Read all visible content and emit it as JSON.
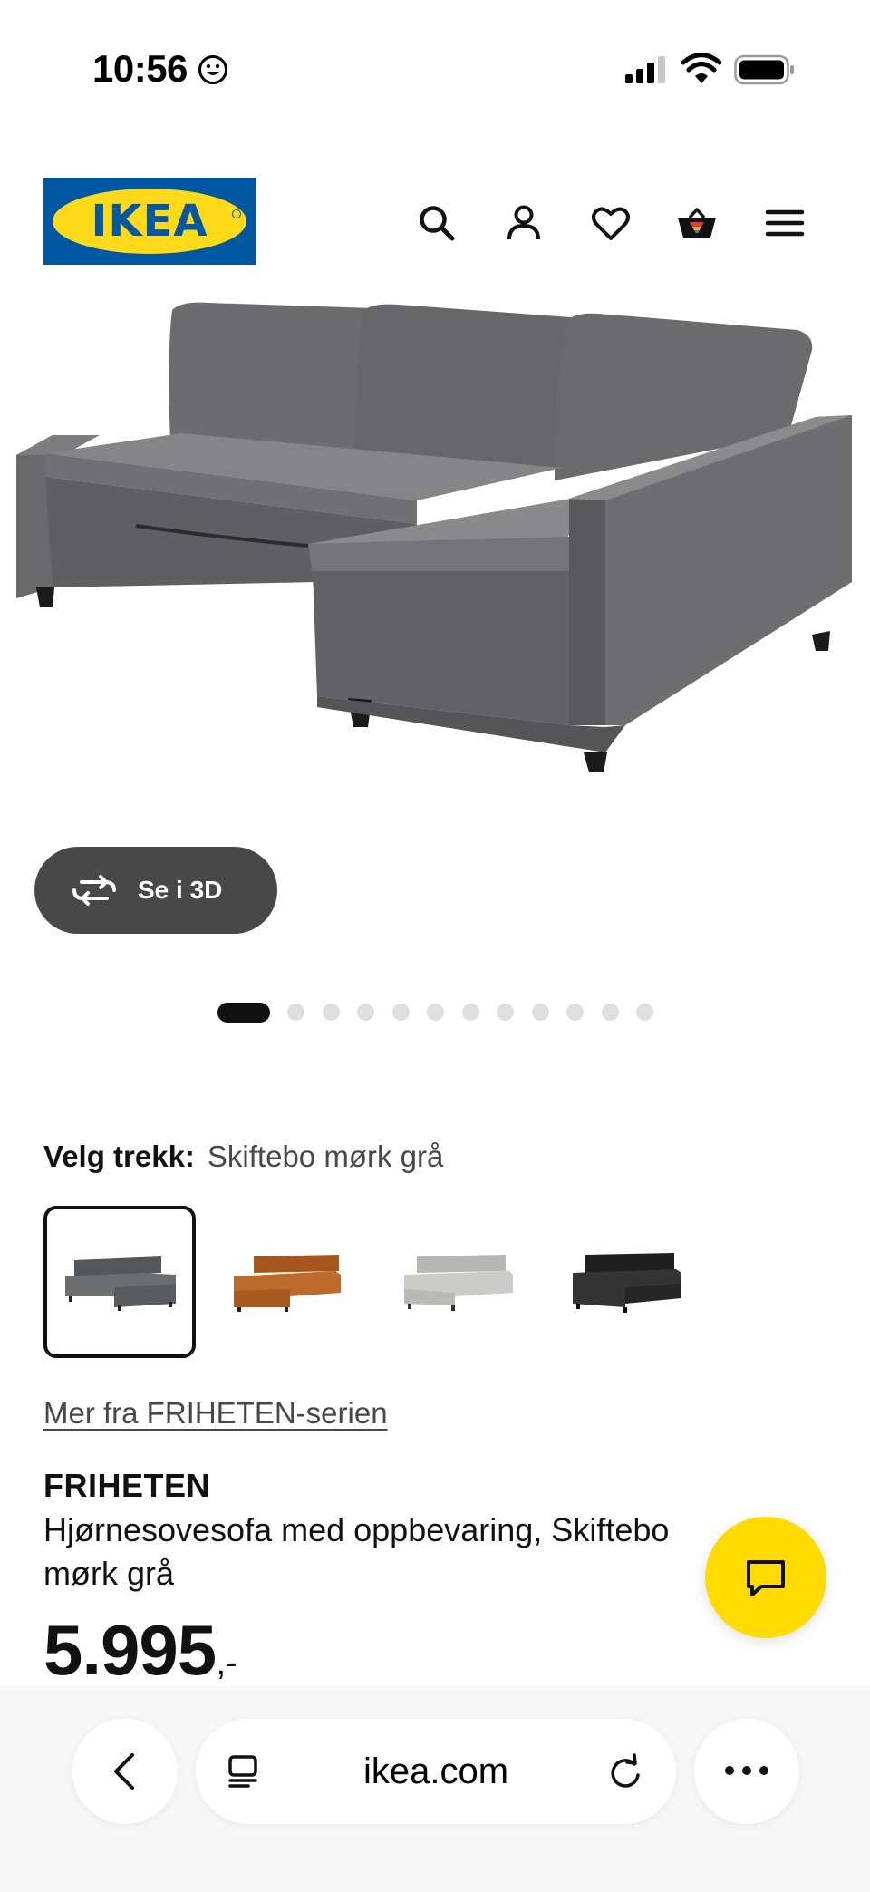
{
  "status_bar": {
    "time": "10:56",
    "status_icons": [
      "smiley-face-icon",
      "cellular-signal-icon",
      "wifi-icon",
      "battery-icon"
    ]
  },
  "header": {
    "logo_text": "IKEA",
    "logo_colors": {
      "background": "#0058a3",
      "ellipse": "#ffda1a"
    },
    "icons": [
      "search-icon",
      "profile-icon",
      "heart-icon",
      "cart-icon",
      "menu-icon"
    ]
  },
  "gallery": {
    "view_3d_label": "Se i 3D",
    "image_count": 12,
    "current_image": 1
  },
  "variant": {
    "label": "Velg trekk:",
    "selected_value": "Skiftebo mørk grå",
    "swatch_colors": [
      "#5f5f61",
      "#b5632a",
      "#c6c7c5",
      "#2a2a2a"
    ],
    "selected_index": 0
  },
  "product": {
    "series_link": "Mer fra FRIHETEN-serien",
    "name": "FRIHETEN",
    "description": "Hjørnesovesofa med oppbevaring, Skiftebo mørk grå",
    "price": "5.995",
    "price_suffix": ",-"
  },
  "browser": {
    "url": "ikea.com"
  },
  "colors": {
    "accent_yellow": "#ffdb00",
    "text": "#111111",
    "pill_dark": "#484848"
  }
}
